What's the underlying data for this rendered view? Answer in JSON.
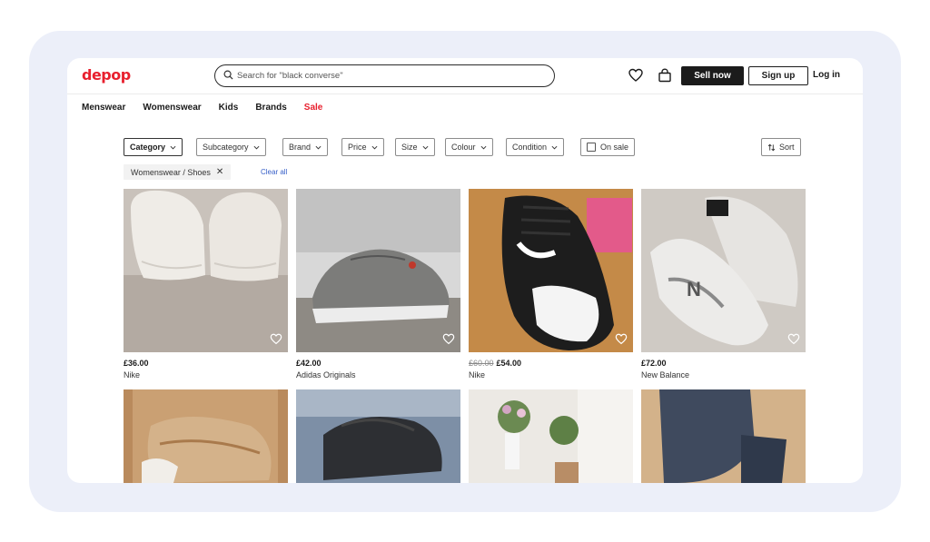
{
  "header": {
    "logo": "depop",
    "search_placeholder": "Search for \"black converse\"",
    "sell_label": "Sell now",
    "signup_label": "Sign up",
    "login_label": "Log in"
  },
  "nav": [
    "Menswear",
    "Womenswear",
    "Kids",
    "Brands",
    "Sale"
  ],
  "filters": {
    "category": "Category",
    "subcategory": "Subcategory",
    "brand": "Brand",
    "price": "Price",
    "size": "Size",
    "colour": "Colour",
    "condition": "Condition",
    "on_sale": "On sale",
    "sort": "Sort"
  },
  "active_filter": "Womenswear / Shoes",
  "clear_all": "Clear all",
  "products": [
    {
      "price": "£36.00",
      "old_price": "",
      "brand": "Nike"
    },
    {
      "price": "£42.00",
      "old_price": "",
      "brand": "Adidas Originals"
    },
    {
      "price": "£54.00",
      "old_price": "£60.00",
      "brand": "Nike"
    },
    {
      "price": "£72.00",
      "old_price": "",
      "brand": "New Balance"
    }
  ],
  "colors": {
    "brand_red": "#e8202e",
    "ink": "#1b1b1b",
    "link": "#3860c8",
    "frame": "#eceff9"
  },
  "icons": [
    "search-icon",
    "heart-icon",
    "bag-icon",
    "chevron-down-icon",
    "close-icon",
    "sort-icon"
  ]
}
